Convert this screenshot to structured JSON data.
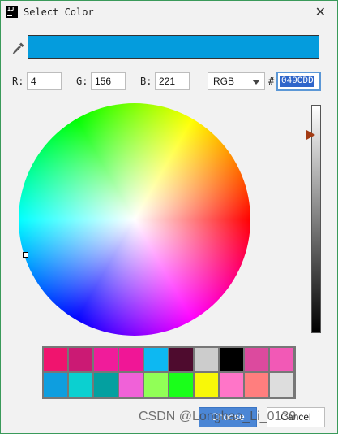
{
  "window": {
    "title": "Select Color",
    "app_icon_text": "IJ",
    "close_glyph": "✕",
    "icons": {
      "app": "intellij-icon",
      "close": "close-icon",
      "picker": "eyedropper-icon"
    }
  },
  "preview": {
    "color": "#049CDD"
  },
  "rgb": {
    "r_label": "R:",
    "r_value": "4",
    "g_label": "G:",
    "g_value": "156",
    "b_label": "B:",
    "b_value": "221"
  },
  "mode": {
    "selected": "RGB"
  },
  "hex": {
    "label": "#",
    "value": "049CDD"
  },
  "brightness_slider": {
    "level": 0.13
  },
  "swatches": [
    [
      "#f0146e",
      "#cb1a74",
      "#f01c9a",
      "#f01696",
      "#0db8f2",
      "#4e0b2e",
      "#cccccc",
      "#000000",
      "#dc4a9e",
      "#f259b6"
    ],
    [
      "#0e9edf",
      "#0bd0d0",
      "#04a0a0",
      "#f061d8",
      "#91ff57",
      "#1aff1a",
      "#f8f808",
      "#ff75c8",
      "#ff7e7e",
      "#dddddd"
    ]
  ],
  "buttons": {
    "choose": "Choose",
    "cancel": "Cancel"
  },
  "watermark": "CSDN @Longhao_Li_0130"
}
